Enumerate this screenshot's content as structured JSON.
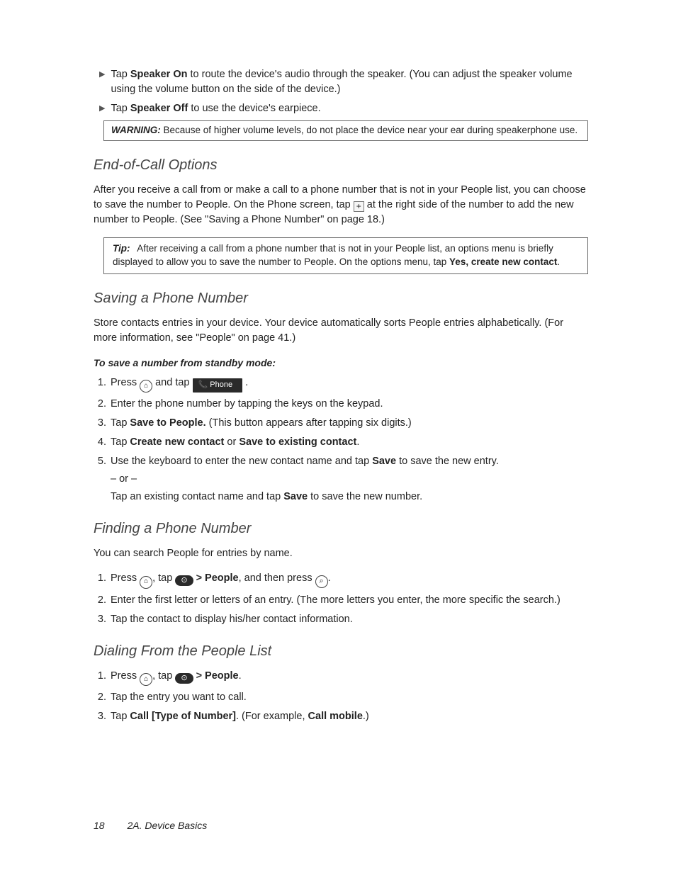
{
  "intro_bullets": {
    "b1_a": "Tap ",
    "b1_bold": "Speaker On",
    "b1_b": " to route the device's audio through the speaker. (You can adjust the speaker volume using the volume button on the side of the device.)",
    "b2_a": "Tap ",
    "b2_bold": "Speaker Off",
    "b2_b": " to use the device's earpiece."
  },
  "warning": {
    "label": "WARNING:",
    "text": "Because of higher volume levels, do not place the device near your ear during speakerphone use."
  },
  "sec1": {
    "title": "End-of-Call Options",
    "para_a": "After you receive a call from or make a call to a phone number that is not in your People list, you can choose to save the number to People. On the Phone screen, tap ",
    "para_b": " at the right side of the number to add the new number to People. (See \"Saving a Phone Number\" on page 18.)"
  },
  "tip": {
    "label": "Tip:",
    "text_a": "After receiving a call from a phone number that is not in your People list, an options menu is briefly displayed to allow you to save the number to People. On the options menu, tap ",
    "bold": "Yes, create new contact",
    "text_b": "."
  },
  "sec2": {
    "title": "Saving a Phone Number",
    "para": "Store contacts entries in your device. Your device automatically sorts People entries alphabetically. (For more information, see \"People\" on page 41.)",
    "sub": "To save a number from standby mode:",
    "steps": {
      "s1_a": "Press ",
      "s1_b": " and tap ",
      "s1_phone": "📞 Phone",
      "s1_c": ".",
      "s2": "Enter the phone number by tapping the keys on the keypad.",
      "s3_a": "Tap ",
      "s3_bold": "Save to People.",
      "s3_b": " (This button appears after tapping six digits.)",
      "s4_a": "Tap ",
      "s4_bold1": "Create new contact",
      "s4_or": " or ",
      "s4_bold2": "Save to existing contact",
      "s4_b": ".",
      "s5_a": "Use the keyboard to enter the new contact name and tap ",
      "s5_bold": "Save",
      "s5_b": " to save the new entry.",
      "s5_or": "– or –",
      "s5_c": "Tap an existing contact name and tap ",
      "s5_bold2": "Save",
      "s5_d": " to save the new number."
    }
  },
  "sec3": {
    "title": "Finding a Phone Number",
    "para": "You can search People for entries by name.",
    "steps": {
      "s1_a": "Press ",
      "s1_b": ", tap ",
      "s1_people": "People",
      "s1_c": ", and then press ",
      "s1_d": ".",
      "s2": "Enter the first letter or letters of an entry. (The more letters you enter, the more specific the search.)",
      "s3": "Tap the contact to display his/her contact information."
    }
  },
  "sec4": {
    "title": "Dialing From the People List",
    "steps": {
      "s1_a": "Press ",
      "s1_b": ", tap ",
      "s1_people": "People",
      "s1_c": ".",
      "s2": "Tap the entry you want to call.",
      "s3_a": "Tap ",
      "s3_bold": "Call [Type of Number]",
      "s3_b": ". (For example, ",
      "s3_bold2": "Call mobile",
      "s3_c": ".)"
    }
  },
  "footer": {
    "page": "18",
    "chapter": "2A. Device Basics"
  },
  "icons": {
    "home": "⌂",
    "apps": "⊙",
    "search": "⌕",
    "plus": "+",
    "gt": ">"
  }
}
